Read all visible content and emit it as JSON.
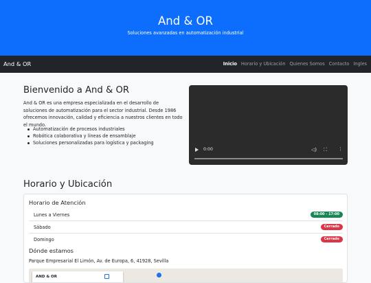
{
  "hero": {
    "title": "And & OR",
    "subtitle": "Soluciones avanzadas en automatización industrial"
  },
  "navbar": {
    "brand": "And & OR",
    "links": [
      "Inicio",
      "Horario y Ubicación",
      "Quienes Somos",
      "Contacto",
      "Ingles"
    ],
    "active": "Inicio"
  },
  "welcome": {
    "title": "Bienvenido a And & OR",
    "text": "And & OR es una empresa especializada en el desarrollo de soluciones de automatización para el sector industrial. Desde 1986 ofrecemos innovación, calidad y eficiencia a nuestros clientes en todo el mundo.",
    "features": [
      "Automatización de procesos industriales",
      "Robótica colaborativa y líneas de ensamblaje",
      "Soluciones personalizadas para logística y packaging"
    ]
  },
  "video": {
    "time": "0:00"
  },
  "schedule": {
    "title": "Horario y Ubicación",
    "hours_title": "Horario de Atención",
    "rows": [
      {
        "day": "Lunes a Viernes",
        "badge": "08:00 - 17:00",
        "status": "open"
      },
      {
        "day": "Sábado",
        "badge": "Cerrado",
        "status": "closed"
      },
      {
        "day": "Domingo",
        "badge": "Cerrado",
        "status": "closed"
      }
    ],
    "location_title": "Dónde estamos",
    "address": "Parque Empresarial El Limón, Av. de Europa, 6, 41928, Sevilla"
  },
  "map": {
    "card_title": "AND & OR"
  },
  "colors": {
    "primary": "#0d6efd",
    "navbar": "#212529",
    "success": "#198754",
    "danger": "#dc3545"
  }
}
